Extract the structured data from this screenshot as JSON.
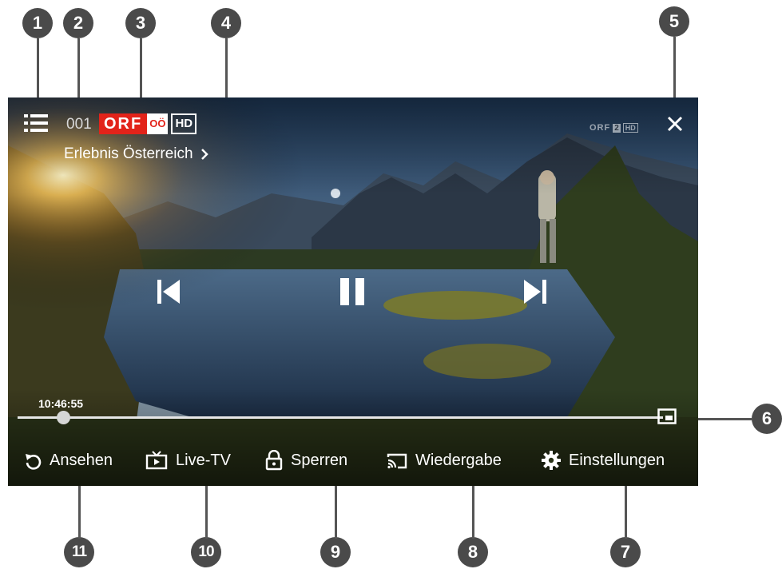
{
  "callouts": [
    "1",
    "2",
    "3",
    "4",
    "5",
    "6",
    "7",
    "8",
    "9",
    "10",
    "11"
  ],
  "player": {
    "channel_number": "001",
    "channel_logo": {
      "text": "ORF",
      "region": "OÖ",
      "quality": "HD"
    },
    "program_title": "Erlebnis Österreich",
    "watermark": {
      "brand": "ORF",
      "number": "2",
      "quality": "HD"
    },
    "current_time": "10:46:55",
    "progress_fraction": 0.07
  },
  "controls": {
    "restart": "Ansehen",
    "live_tv": "Live-TV",
    "lock": "Sperren",
    "cast": "Wiedergabe",
    "settings": "Einstellungen"
  },
  "icons": [
    "menu-icon",
    "close-icon",
    "previous-icon",
    "pause-icon",
    "next-icon",
    "pip-icon",
    "restart-icon",
    "tv-icon",
    "lock-icon",
    "cast-icon",
    "gear-icon",
    "chevron-right-icon"
  ],
  "colors": {
    "orf_red": "#e2231a",
    "badge": "#4a4a4a",
    "overlay_text": "#ffffff"
  }
}
